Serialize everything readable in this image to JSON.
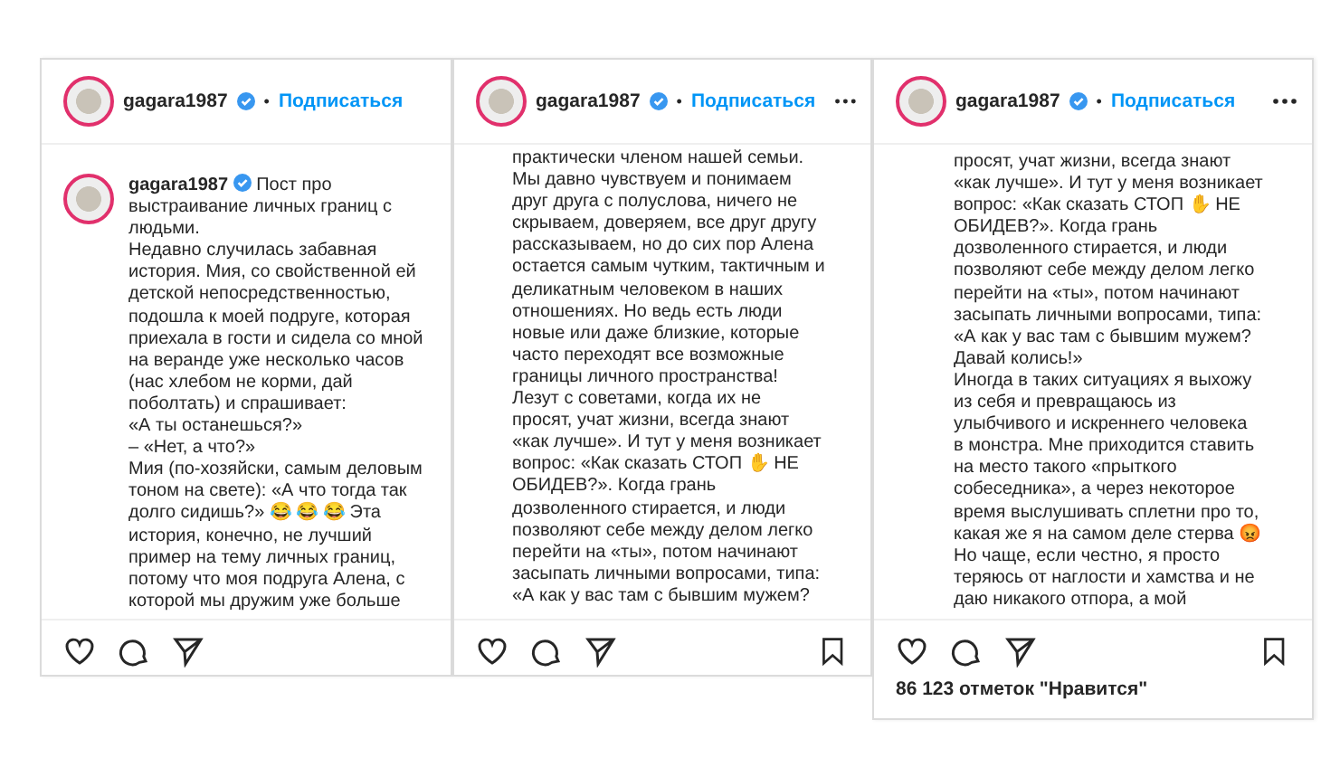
{
  "posts": [
    {
      "username": "gagara1987",
      "verified": true,
      "separator": "•",
      "follow": "Подписаться",
      "more_menu": false,
      "bookmark": false,
      "caption_author": "gagara1987",
      "caption": "Пост про\nвыстраивание личных границ с\nлюдьми.\nНедавно случилась забавная\nистория. Мия, со свойственной ей\nдетской непосредственностью,\nподошла к моей подруге, которая\nприехала в гости и сидела со мной\nна веранде уже несколько часов\n(нас хлебом не корми, дай\nпоболтать) и спрашивает:\n«А ты останешься?»\n– «Нет, а что?»\nМия (по-хозяйски, самым деловым\nтоном на свете): «А что тогда так\nдолго сидишь?» 😂 😂 😂 Эта\nистория, конечно, не лучший\nпример на тему личных границ,\nпотому что моя подруга Алена, с\nкоторой мы дружим уже больше"
    },
    {
      "username": "gagara1987",
      "verified": true,
      "separator": "•",
      "follow": "Подписаться",
      "more_menu": true,
      "bookmark": true,
      "caption": "практически членом нашей семьи.\nМы давно чувствуем и понимаем\nдруг друга с полуслова, ничего не\nскрываем, доверяем, все друг другу\nрассказываем, но до сих пор Алена\nостается самым чутким, тактичным и\nделикатным человеком в наших\nотношениях. Но ведь есть люди\nновые или даже близкие, которые\nчасто переходят все возможные\nграницы личного пространства!\nЛезут с советами, когда их не\nпросят, учат жизни, всегда знают\n«как лучше». И тут у меня возникает\nвопрос: «Как сказать СТОП ✋ НЕ\nОБИДЕВ?». Когда грань\nдозволенного стирается, и люди\nпозволяют себе между делом легко\nперейти на «ты», потом начинают\nзасыпать личными вопросами, типа:\n«А как у вас там с бывшим мужем?"
    },
    {
      "username": "gagara1987",
      "verified": true,
      "separator": "•",
      "follow": "Подписаться",
      "more_menu": true,
      "bookmark": true,
      "caption": "просят, учат жизни, всегда знают\n«как лучше». И тут у меня возникает\nвопрос: «Как сказать СТОП ✋ НЕ\nОБИДЕВ?». Когда грань\nдозволенного стирается, и люди\nпозволяют себе между делом легко\nперейти на «ты», потом начинают\nзасыпать личными вопросами, типа:\n«А как у вас там с бывшим мужем?\nДавай колись!»\nИногда в таких ситуациях я выхожу\nиз себя и превращаюсь из\nулыбчивого и искреннего человека\nв монстра. Мне приходится ставить\nна место такого «прыткого\nсобеседника», а через некоторое\nвремя выслушивать сплетни про то,\nкакая же я на самом деле стерва 😡\nНо чаще, если честно, я просто\nтеряюсь от наглости и хамства и не\nдаю никакого отпора, а мой",
      "likes": "86 123 отметок \"Нравится\""
    }
  ]
}
